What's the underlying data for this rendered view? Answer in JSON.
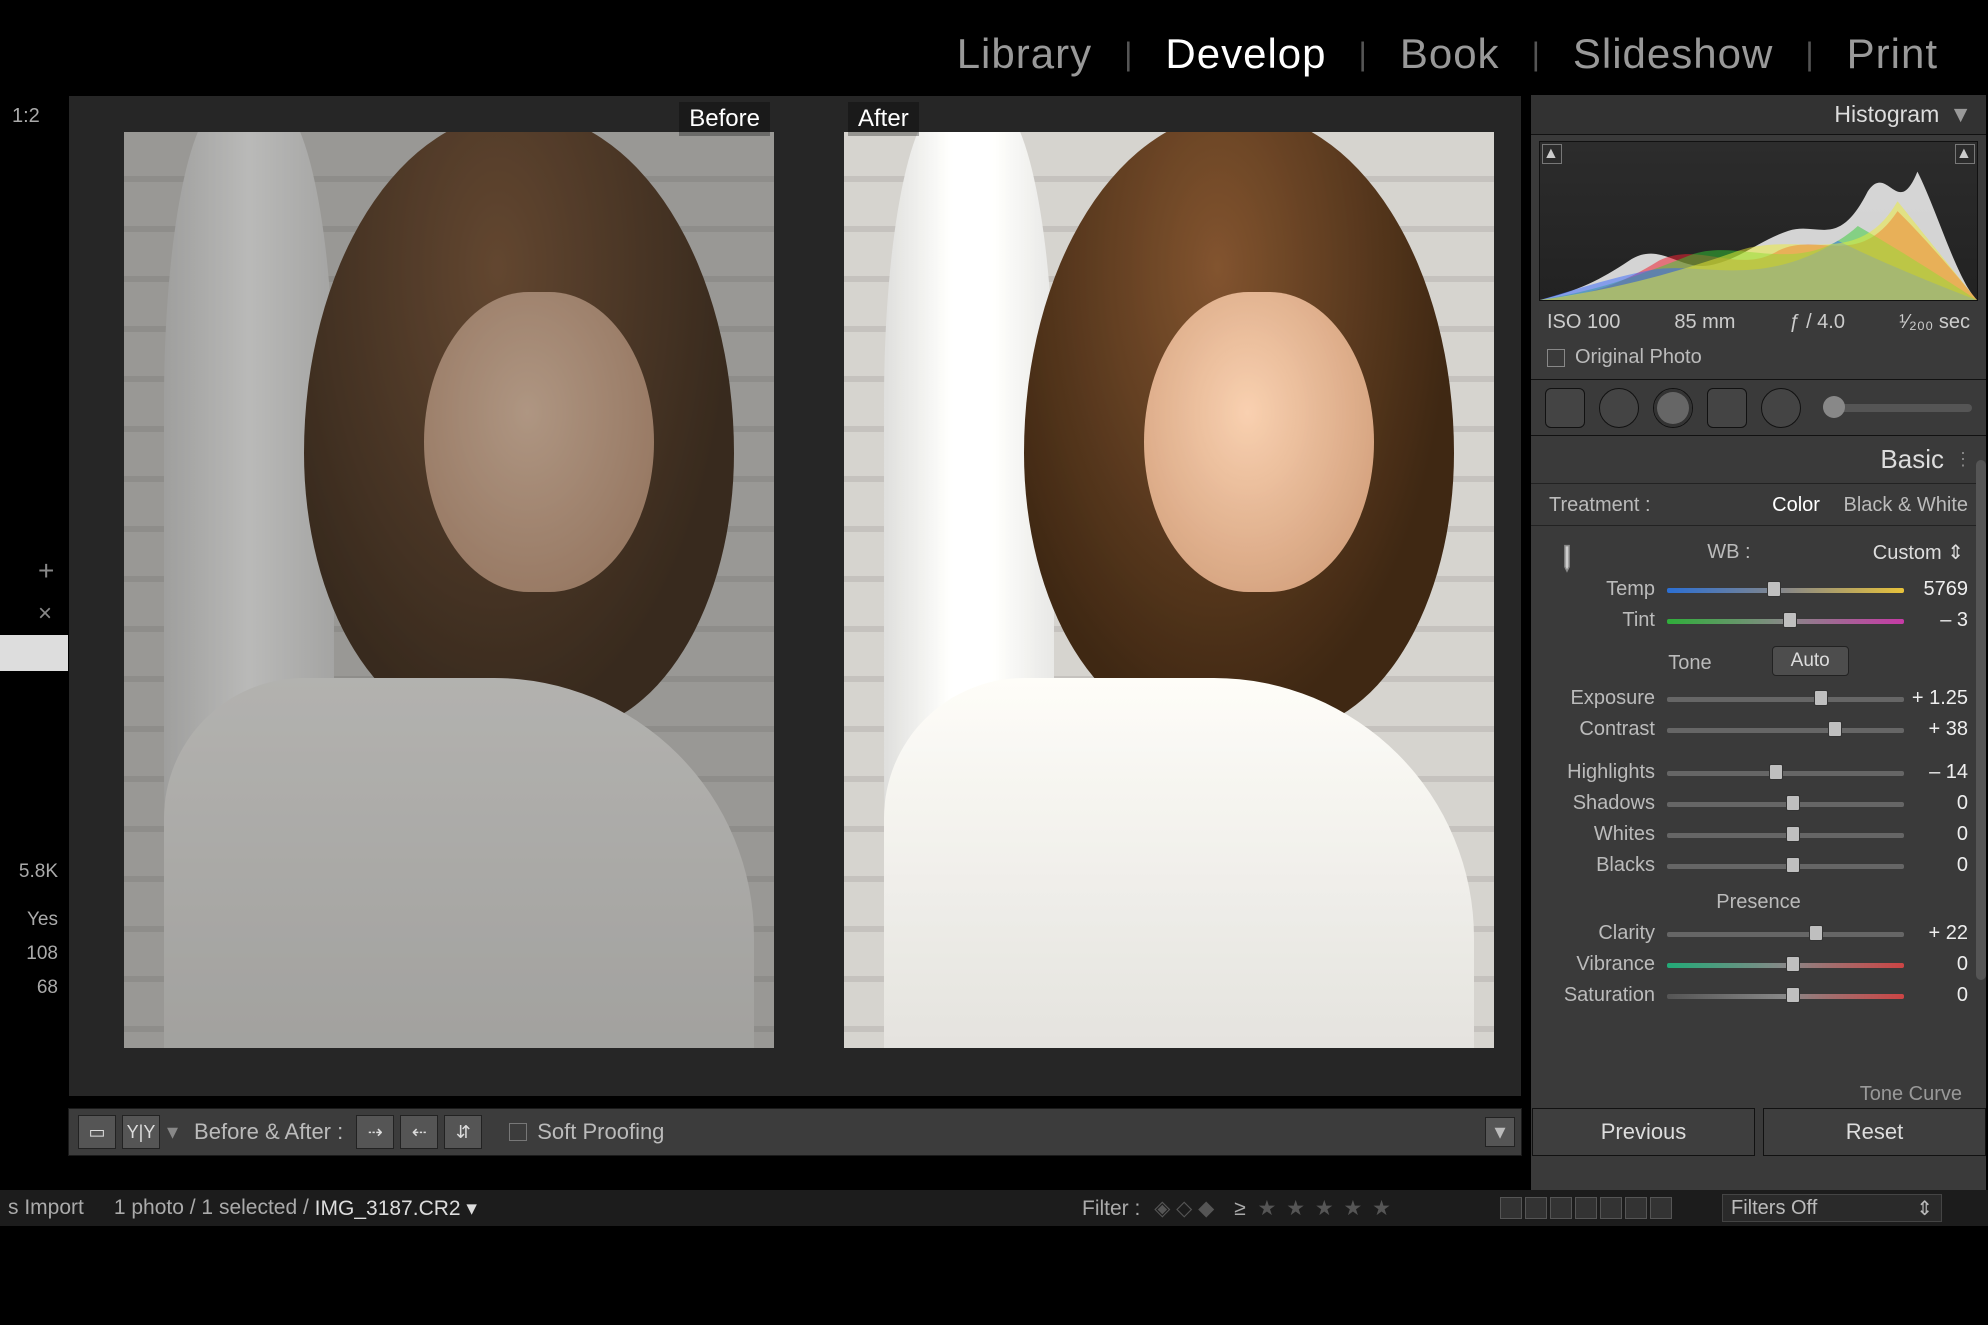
{
  "modules": {
    "library": "Library",
    "develop": "Develop",
    "book": "Book",
    "slideshow": "Slideshow",
    "print": "Print",
    "active": "develop"
  },
  "left": {
    "ratio": "1:2",
    "temp": "5.8K",
    "flash": "Yes",
    "iso": "108",
    "mm": "68"
  },
  "canvas": {
    "before": "Before",
    "after": "After"
  },
  "toolbar": {
    "ba_label": "Before & After :",
    "softproof": "Soft Proofing"
  },
  "status": {
    "prefix": "s Import",
    "count": "1 photo / 1 selected /",
    "filename": "IMG_3187.CR2",
    "filter_label": "Filter :",
    "ge": "≥",
    "filters_off": "Filters Off"
  },
  "right": {
    "histogram": "Histogram",
    "exif": {
      "iso": "ISO 100",
      "focal": "85 mm",
      "ap": "ƒ / 4.0",
      "shutter": "¹⁄₂₀₀ sec"
    },
    "original": "Original Photo",
    "basic": "Basic",
    "treatment_label": "Treatment :",
    "color": "Color",
    "bw": "Black & White",
    "wb_label": "WB :",
    "wb_value": "Custom",
    "temp_label": "Temp",
    "temp_value": "5769",
    "tint_label": "Tint",
    "tint_value": "– 3",
    "tone": "Tone",
    "auto": "Auto",
    "exposure_label": "Exposure",
    "exposure_value": "+ 1.25",
    "contrast_label": "Contrast",
    "contrast_value": "+ 38",
    "highlights_label": "Highlights",
    "highlights_value": "– 14",
    "shadows_label": "Shadows",
    "shadows_value": "0",
    "whites_label": "Whites",
    "whites_value": "0",
    "blacks_label": "Blacks",
    "blacks_value": "0",
    "presence": "Presence",
    "clarity_label": "Clarity",
    "clarity_value": "+ 22",
    "vibrance_label": "Vibrance",
    "vibrance_value": "0",
    "saturation_label": "Saturation",
    "saturation_value": "0",
    "tonecurve": "Tone Curve",
    "previous": "Previous",
    "reset": "Reset"
  }
}
